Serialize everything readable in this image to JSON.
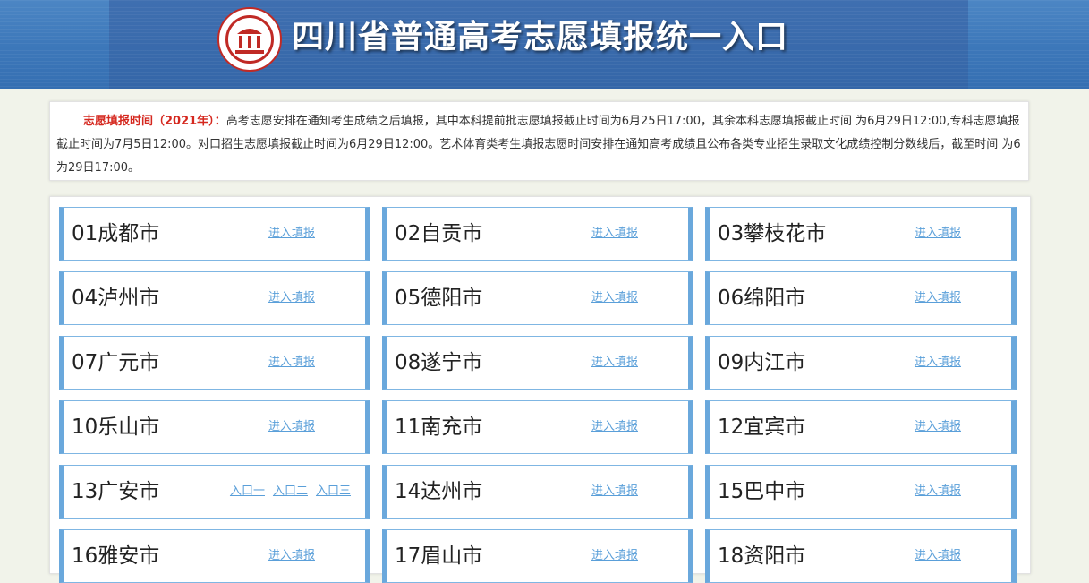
{
  "header": {
    "title": "四川省普通高考志愿填报统一入口",
    "seal_icon": "sichuan-education-exam-seal"
  },
  "notice": {
    "label": "志愿填报时间（2021年）：",
    "text": "高考志愿安排在通知考生成绩之后填报，其中本科提前批志愿填报截止时间为6月25日17:00，其余本科志愿填报截止时间 为6月29日12:00,专科志愿填报截止时间为7月5日12:00。对口招生志愿填报截止时间为6月29日12:00。艺术体育类考生填报志愿时间安排在通知高考成绩且公布各类专业招生录取文化成绩控制分数线后，截至时间 为6为29日17:00。"
  },
  "cities": [
    {
      "name": "01成都市",
      "links": [
        "进入填报"
      ]
    },
    {
      "name": "02自贡市",
      "links": [
        "进入填报"
      ]
    },
    {
      "name": "03攀枝花市",
      "links": [
        "进入填报"
      ]
    },
    {
      "name": "04泸州市",
      "links": [
        "进入填报"
      ]
    },
    {
      "name": "05德阳市",
      "links": [
        "进入填报"
      ]
    },
    {
      "name": "06绵阳市",
      "links": [
        "进入填报"
      ]
    },
    {
      "name": "07广元市",
      "links": [
        "进入填报"
      ]
    },
    {
      "name": "08遂宁市",
      "links": [
        "进入填报"
      ]
    },
    {
      "name": "09内江市",
      "links": [
        "进入填报"
      ]
    },
    {
      "name": "10乐山市",
      "links": [
        "进入填报"
      ]
    },
    {
      "name": "11南充市",
      "links": [
        "进入填报"
      ]
    },
    {
      "name": "12宜宾市",
      "links": [
        "进入填报"
      ]
    },
    {
      "name": "13广安市",
      "links": [
        "入口一",
        "入口二",
        "入口三"
      ]
    },
    {
      "name": "14达州市",
      "links": [
        "进入填报"
      ]
    },
    {
      "name": "15巴中市",
      "links": [
        "进入填报"
      ]
    },
    {
      "name": "16雅安市",
      "links": [
        "进入填报"
      ]
    },
    {
      "name": "17眉山市",
      "links": [
        "进入填报"
      ]
    },
    {
      "name": "18资阳市",
      "links": [
        "进入填报"
      ]
    }
  ],
  "colors": {
    "header_blue": "#3d78ba",
    "card_border": "#6aa8dc",
    "link": "#5a9fd9",
    "notice_label": "#d5281f"
  }
}
